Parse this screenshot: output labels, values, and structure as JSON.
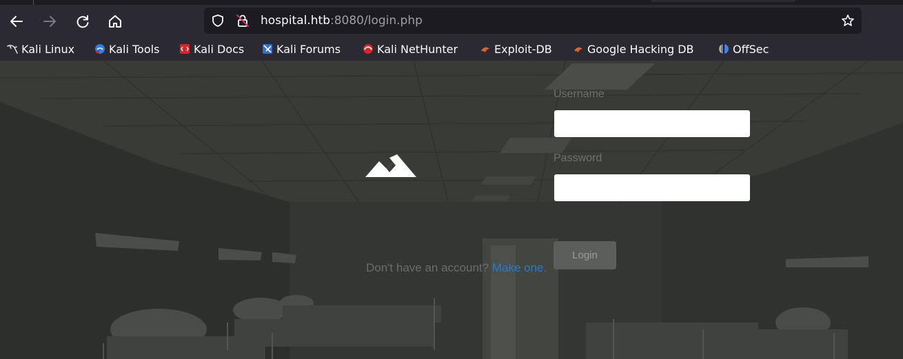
{
  "browser": {
    "nav": {
      "back_icon": "arrow-left-icon",
      "forward_icon": "arrow-right-icon",
      "reload_icon": "reload-icon",
      "home_icon": "home-icon"
    },
    "url": {
      "host": "hospital.htb",
      "rest": ":8080/login.php"
    },
    "bookmarks": [
      {
        "label": "Kali Linux",
        "icon": "kali-dragon-icon",
        "color": "#dddddd"
      },
      {
        "label": "Kali Tools",
        "icon": "kali-tools-icon",
        "color": "#2f7fe0"
      },
      {
        "label": "Kali Docs",
        "icon": "kali-docs-icon",
        "color": "#d6262b"
      },
      {
        "label": "Kali Forums",
        "icon": "kali-forums-icon",
        "color": "#2f6fd6"
      },
      {
        "label": "Kali NetHunter",
        "icon": "kali-nethunter-icon",
        "color": "#d6262b"
      },
      {
        "label": "Exploit-DB",
        "icon": "exploit-db-icon",
        "color": "#e2612b"
      },
      {
        "label": "Google Hacking DB",
        "icon": "ghdb-icon",
        "color": "#e2612b"
      },
      {
        "label": "OffSec",
        "icon": "offsec-icon",
        "color": "#4a7fe0"
      }
    ]
  },
  "login": {
    "logo_icon": "mountain-logo-icon",
    "username_label": "Username",
    "username_value": "",
    "password_label": "Password",
    "password_value": "",
    "login_button": "Login",
    "signup_text": "Don't have an account?",
    "signup_link": "Make one",
    "signup_suffix": "."
  },
  "colors": {
    "link": "#1a7fe0",
    "browser_chrome": "#2b2a33",
    "urlbar": "#1c1b22"
  }
}
